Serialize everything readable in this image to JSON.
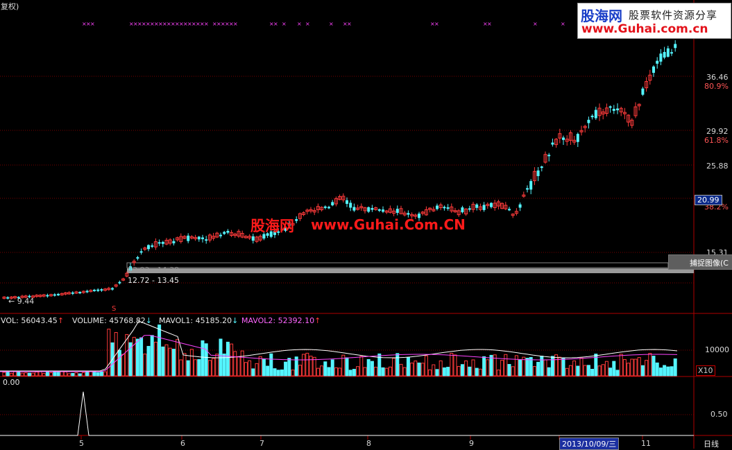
{
  "header": {
    "adjust_label": "复权)",
    "capture_button": "捕捉图像(C"
  },
  "logo": {
    "brand": "股海网",
    "slogan": "股票软件资源分享",
    "url": "www.Guhai.com.cn"
  },
  "watermark": {
    "brand": "股海网",
    "url": "www.Guhai.Com.CN"
  },
  "price_axis": {
    "labels": [
      {
        "price": "36.46",
        "pct": "80.9%"
      },
      {
        "price": "29.92",
        "pct": "61.8%"
      },
      {
        "price": "25.88",
        "pct": ""
      },
      {
        "price": "",
        "pct": "38.2%"
      },
      {
        "price": "15.31",
        "pct": ""
      }
    ],
    "current_price": "20.99"
  },
  "chart_annotations": {
    "low_marker": "← 9.44",
    "range_top": "13.82 - 14.38",
    "range_bottom": "12.72 - 13.45",
    "signal_s": "S"
  },
  "volume_panel": {
    "vol": {
      "label": "VOL: 56043.45",
      "arrow": "↑"
    },
    "volume": {
      "label": "VOLUME: 45768.82",
      "arrow": "↓"
    },
    "mavol1": {
      "label": "MAVOL1: 45185.20",
      "arrow": "↓"
    },
    "mavol2": {
      "label": "MAVOL2: 52392.10",
      "arrow": "↑"
    },
    "axis_10000": "10000",
    "x10": "X10"
  },
  "indicator_panel": {
    "value": "0.00",
    "axis_050": "0.50"
  },
  "x_axis": {
    "months": [
      "5",
      "6",
      "7",
      "8",
      "9",
      "11"
    ],
    "cursor_date": "2013/10/09/三",
    "period": "日线"
  },
  "colors": {
    "up": "#ff3b3b",
    "down": "#54f5ff",
    "grid": "#7a0000",
    "signal": "#ff44ff"
  }
}
